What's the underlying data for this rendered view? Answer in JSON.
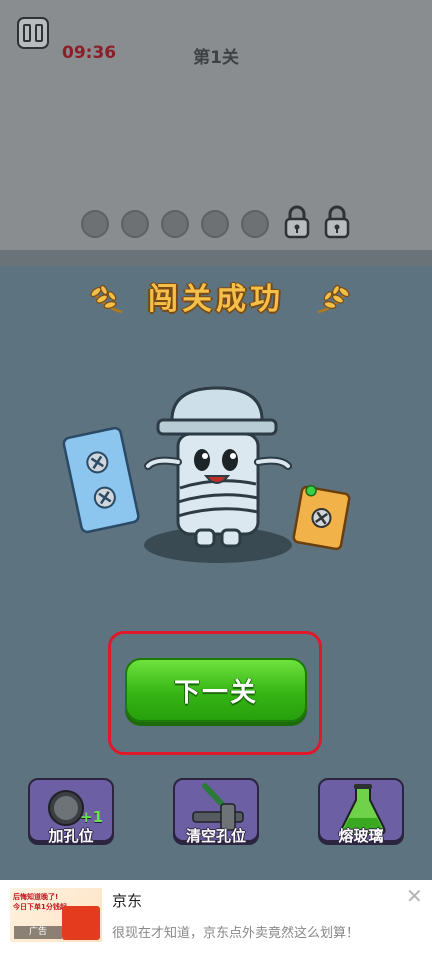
{
  "header": {
    "timer": "09:36",
    "level": "第1关"
  },
  "progress": {
    "open_slots": 5,
    "locked_slots": 2
  },
  "result": {
    "title": "闯关成功",
    "next_button": "下一关"
  },
  "tools": [
    {
      "label": "加孔位",
      "badge": "+1",
      "icon": "hole-icon"
    },
    {
      "label": "清空孔位",
      "icon": "hammer-icon"
    },
    {
      "label": "熔玻璃",
      "icon": "flask-icon"
    }
  ],
  "ad": {
    "advertiser": "京东",
    "description": "很现在才知道，京东点外卖竟然这么划算！",
    "tag": "广告",
    "thumb_line1": "后悔知道晚了!",
    "thumb_line2": "今日下单1分钱起"
  },
  "colors": {
    "overlay": "#5d7380",
    "next_button": "#36b515",
    "highlight": "#e0182a",
    "tool_bg": "#6d5fa3",
    "title": "#f5c04a"
  }
}
